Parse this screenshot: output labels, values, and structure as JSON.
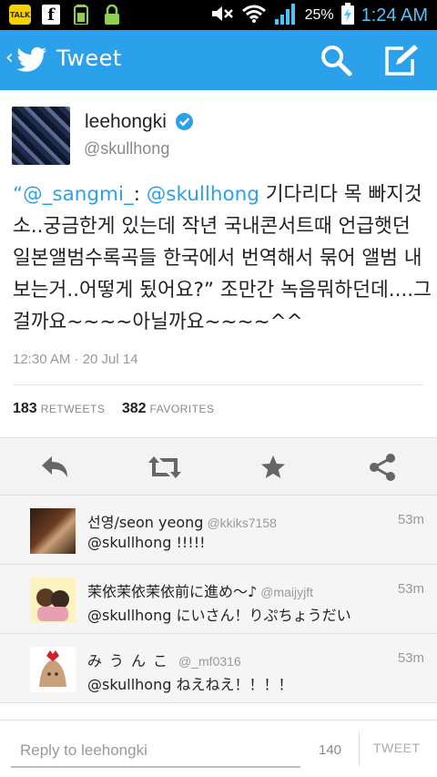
{
  "status_bar": {
    "app_icons": [
      "talk-icon",
      "facebook-icon",
      "battery-app-icon",
      "lock-icon"
    ],
    "talk_label": "TALK",
    "fb_label": "f",
    "battery": "25%",
    "time": "1:24 AM"
  },
  "appbar": {
    "title": "Tweet"
  },
  "profile": {
    "name": "leehongki",
    "handle": "@skullhong"
  },
  "tweet": {
    "quote_open": "“",
    "mention1": "@_sangmi_",
    "sep": ": ",
    "mention2": "@skullhong",
    "body": " 기다리다 목 빠지것소..궁금한게 있는데 작년 국내콘서트때 언급햇던 일본앨범수록곡들 한국에서 번역해서 묶어 앨범 내보는거..어떻게 됬어요?” 조만간 녹음뭐하던데....그걸까요~~~~아닐까요~~~~^^",
    "date": "12:30 AM · 20 Jul 14"
  },
  "stats": {
    "retweets_count": "183",
    "retweets_label": "RETWEETS",
    "favorites_count": "382",
    "favorites_label": "FAVORITES"
  },
  "replies": [
    {
      "name": "선영/seon yeong",
      "handle": "@kkiks7158",
      "time": "53m",
      "text": "@skullhong !!!!!"
    },
    {
      "name": "茉依茉依茉依前に進め～♪",
      "handle": "@maijyjft",
      "time": "53m",
      "text": "@skullhong にいさん！りぷちょうだい"
    },
    {
      "name": "みうんこ",
      "handle": "@_mf0316",
      "time": "53m",
      "text": "@skullhong ねえねえ！！！！"
    }
  ],
  "compose": {
    "placeholder": "Reply to leehongki",
    "counter": "140",
    "tweet_label": "TWEET"
  },
  "colors": {
    "brand": "#2ba1eb",
    "status_time": "#4fc3f7"
  }
}
